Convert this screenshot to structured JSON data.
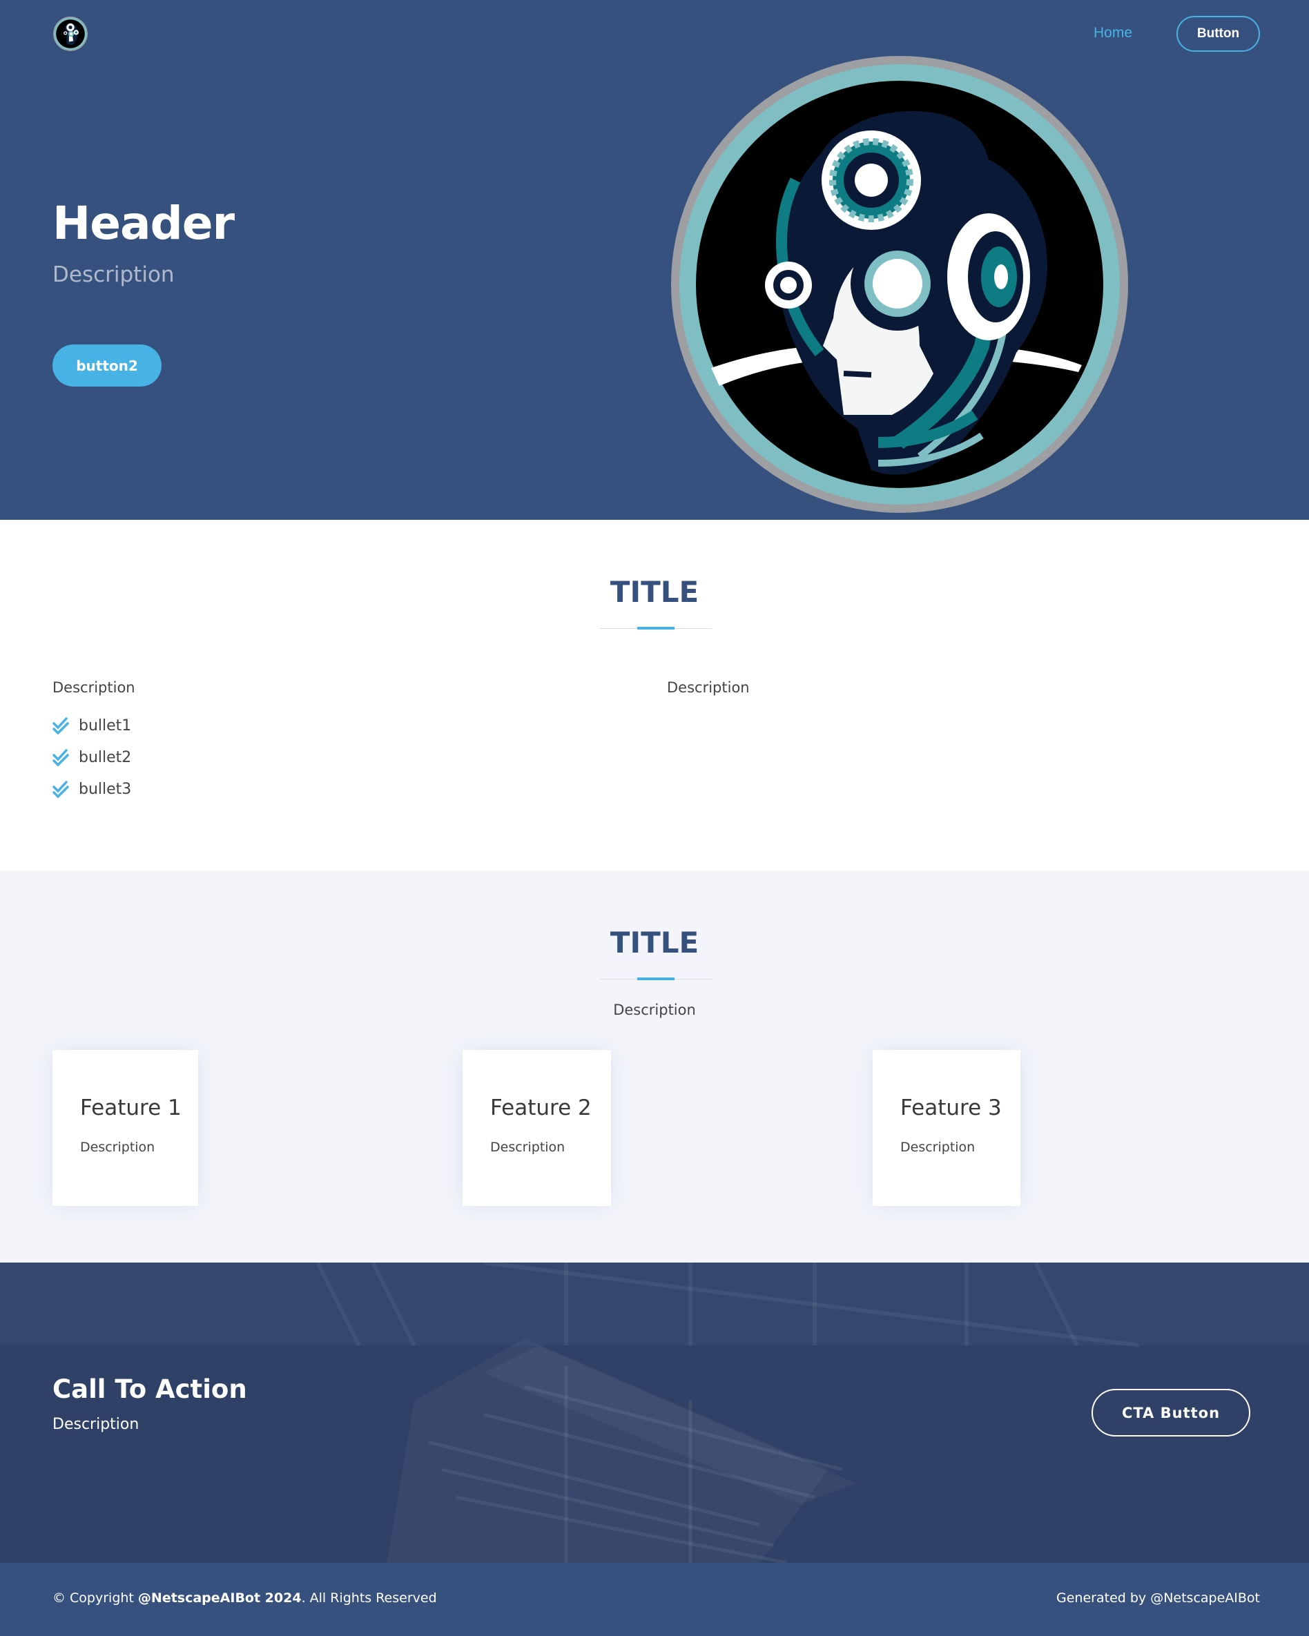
{
  "nav": {
    "home_label": "Home",
    "button_label": "Button"
  },
  "hero": {
    "title": "Header",
    "description": "Description",
    "button_label": "button2"
  },
  "about": {
    "title": "TITLE",
    "left_description": "Description",
    "right_description": "Description",
    "bullets": [
      "bullet1",
      "bullet2",
      "bullet3"
    ]
  },
  "features": {
    "title": "TITLE",
    "description": "Description",
    "cards": [
      {
        "title": "Feature 1",
        "description": "Description"
      },
      {
        "title": "Feature 2",
        "description": "Description"
      },
      {
        "title": "Feature 3",
        "description": "Description"
      }
    ]
  },
  "cta": {
    "title": "Call To Action",
    "description": "Description",
    "button_label": "CTA Button"
  },
  "footer": {
    "copyright_prefix": "© Copyright ",
    "copyright_brand": "@NetscapeAIBot 2024",
    "copyright_suffix": ". All Rights Reserved",
    "generated_by": "Generated by @NetscapeAIBot"
  },
  "colors": {
    "primary": "#37517e",
    "accent": "#47b2e4",
    "section_alt": "#f3f5fa"
  },
  "icons": {
    "logo": "robot-gear-head-logo",
    "bullet": "double-check-icon"
  }
}
